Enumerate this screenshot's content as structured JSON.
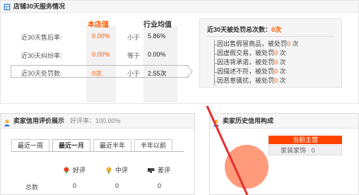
{
  "colors": {
    "accent": "#ff5500",
    "store_col_bg": "#f2f2f2",
    "penalty_bg": "#f5f5f5",
    "red_tag": "#ff4400",
    "pie_fill": "#ff9a7a",
    "annotation_stroke": "#e62e2e"
  },
  "icons": [
    "store-window-icon",
    "user-icon",
    "smile-flower-icon",
    "neutral-flower-icon",
    "thumb-down-icon",
    "tab-arrow-icon"
  ],
  "service": {
    "title": "店铺30天服务情况",
    "col_store": "本店值",
    "col_avg": "行业均值",
    "rows": [
      {
        "label": "近30天售后率:",
        "store": "0.00%",
        "cmp": "小于",
        "avg": "5.86%"
      },
      {
        "label": "近30天纠纷率:",
        "store": "0.00%",
        "cmp": "等于",
        "avg": "0.00%"
      },
      {
        "label": "近30天处罚数:",
        "store": "0次",
        "cmp": "小于",
        "avg": "2.55次"
      }
    ],
    "penalty": {
      "title_prefix": "近30天被处罚总次数：",
      "title_value": "0次",
      "items": [
        {
          "text": "因出售假冒商品，被处罚",
          "value": "0",
          "unit": "次"
        },
        {
          "text": "因虚假交易，被处罚",
          "value": "0",
          "unit": "次"
        },
        {
          "text": "因违背承诺，被处罚",
          "value": "0",
          "unit": "次"
        },
        {
          "text": "因描述不符，被处罚",
          "value": "0",
          "unit": "次"
        },
        {
          "text": "因恶意骚扰，被处罚",
          "value": "0",
          "unit": "次"
        }
      ]
    }
  },
  "credit": {
    "title": "卖家信用评价展示",
    "rate_label": "好评率：",
    "rate_value": "100.00%",
    "tabs": [
      "最近一周",
      "最近一月",
      "最近半年",
      "半年以前"
    ],
    "active_tab": 1,
    "headers": [
      "好评",
      "中评",
      "差评"
    ],
    "row_label": "总数",
    "row_values": [
      "0",
      "0",
      "0"
    ]
  },
  "history": {
    "title": "卖家历史信用构成",
    "main_label": "当前主营",
    "category": "家装家饰",
    "category_value": "0"
  }
}
